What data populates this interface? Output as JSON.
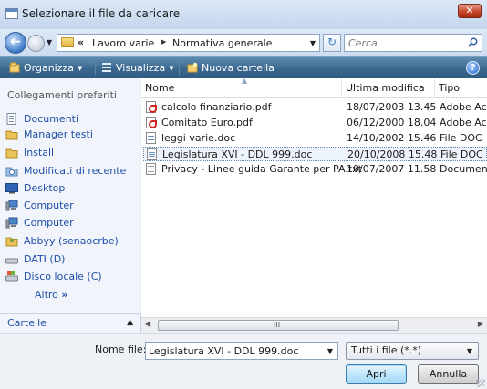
{
  "window": {
    "title": "Selezionare il file da caricare",
    "close_glyph": "✕"
  },
  "address": {
    "raquo": "«",
    "crumbs": [
      "Lavoro varie",
      "Normativa generale"
    ],
    "search_placeholder": "Cerca"
  },
  "toolbar": {
    "organize": "Organizza",
    "view": "Visualizza",
    "new_folder": "Nuova cartella",
    "help_glyph": "?"
  },
  "nav": {
    "heading": "Collegamenti preferiti",
    "items": [
      {
        "label": "Documenti",
        "icon": "documents-icon"
      },
      {
        "label": "Manager testi",
        "icon": "folder-icon"
      },
      {
        "label": "Install",
        "icon": "folder-icon"
      },
      {
        "label": "Modificati di recente",
        "icon": "recent-icon"
      },
      {
        "label": "Desktop",
        "icon": "desktop-icon"
      },
      {
        "label": "Computer",
        "icon": "computer-icon"
      },
      {
        "label": "Computer",
        "icon": "computer-icon"
      },
      {
        "label": "Abbyy (senaocrbe)",
        "icon": "user-folder-icon"
      },
      {
        "label": "DATI (D)",
        "icon": "drive-icon"
      },
      {
        "label": "Disco locale (C)",
        "icon": "local-disk-icon"
      }
    ],
    "more": "Altro",
    "more_glyph": "»",
    "folders": "Cartelle"
  },
  "filelist": {
    "columns": [
      "Nome",
      "Ultima modifica",
      "Tipo"
    ],
    "rows": [
      {
        "name": "calcolo finanziario.pdf",
        "modified": "18/07/2003 13.45",
        "type": "Adobe Acro",
        "icon": "pdf"
      },
      {
        "name": "Comitato Euro.pdf",
        "modified": "06/12/2000 18.04",
        "type": "Adobe Acro",
        "icon": "pdf"
      },
      {
        "name": "leggi varie.doc",
        "modified": "14/10/2002 15.46",
        "type": "File DOC",
        "icon": "doc"
      },
      {
        "name": "Legislatura XVI - DDL 999.doc",
        "modified": "20/10/2008 15.48",
        "type": "File DOC",
        "icon": "doc",
        "selected": true
      },
      {
        "name": "Privacy - Linee guida Garante per PA.txt",
        "modified": "10/07/2007 11.58",
        "type": "Documento",
        "icon": "txt"
      }
    ],
    "scroll_grip": "III"
  },
  "bottom": {
    "filename_label": "Nome file:",
    "filename_value": "Legislatura XVI - DDL 999.doc",
    "filetype": "Tutti i file (*.*)",
    "open": "Apri",
    "cancel": "Annulla"
  }
}
